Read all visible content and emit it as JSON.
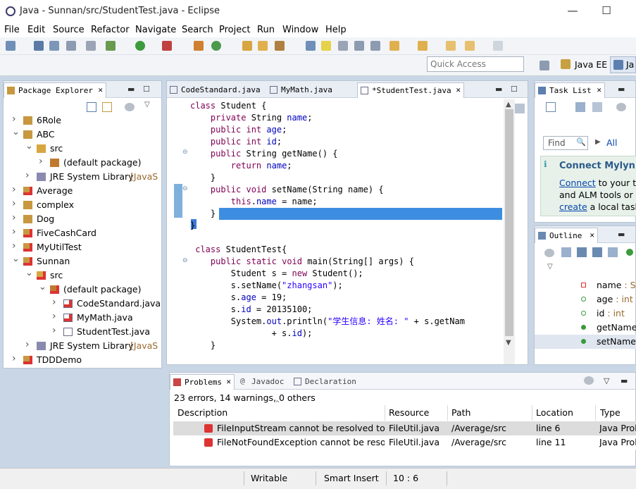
{
  "window": {
    "title": "Java - Sunnan/src/StudentTest.java - Eclipse",
    "minimize": "—",
    "maximize": "☐"
  },
  "menu": [
    "File",
    "Edit",
    "Source",
    "Refactor",
    "Navigate",
    "Search",
    "Project",
    "Run",
    "Window",
    "Help"
  ],
  "quick_access": {
    "placeholder": "Quick Access"
  },
  "perspectives": {
    "javaee": "Java EE",
    "java": "Ja"
  },
  "package_explorer": {
    "tab": "Package Explorer",
    "items": [
      {
        "label": "6Role",
        "level": 0,
        "expanded": false,
        "icon": "project-icon"
      },
      {
        "label": "ABC",
        "level": 0,
        "expanded": true,
        "icon": "project-icon"
      },
      {
        "label": "src",
        "level": 1,
        "expanded": true,
        "icon": "source-folder-icon"
      },
      {
        "label": "(default package)",
        "level": 2,
        "expanded": false,
        "icon": "package-icon"
      },
      {
        "label": "JRE System Library",
        "decoration": "[JavaS",
        "level": 1,
        "expanded": false,
        "icon": "library-icon"
      },
      {
        "label": "Average",
        "level": 0,
        "expanded": false,
        "icon": "project-error-icon"
      },
      {
        "label": "complex",
        "level": 0,
        "expanded": false,
        "icon": "project-icon"
      },
      {
        "label": "Dog",
        "level": 0,
        "expanded": false,
        "icon": "project-icon"
      },
      {
        "label": "FiveCashCard",
        "level": 0,
        "expanded": false,
        "icon": "project-error-icon"
      },
      {
        "label": "MyUtilTest",
        "level": 0,
        "expanded": false,
        "icon": "project-error-icon"
      },
      {
        "label": "Sunnan",
        "level": 0,
        "expanded": true,
        "icon": "project-error-icon"
      },
      {
        "label": "src",
        "level": 1,
        "expanded": true,
        "icon": "source-folder-error-icon"
      },
      {
        "label": "(default package)",
        "level": 2,
        "expanded": true,
        "icon": "package-error-icon"
      },
      {
        "label": "CodeStandard.java",
        "level": 3,
        "expanded": false,
        "icon": "java-file-error-icon"
      },
      {
        "label": "MyMath.java",
        "level": 3,
        "expanded": false,
        "icon": "java-file-error-icon"
      },
      {
        "label": "StudentTest.java",
        "level": 3,
        "expanded": false,
        "icon": "java-file-icon"
      },
      {
        "label": "JRE System Library",
        "decoration": "[JavaS",
        "level": 1,
        "expanded": false,
        "icon": "library-icon"
      },
      {
        "label": "TDDDemo",
        "level": 0,
        "expanded": false,
        "icon": "project-error-icon"
      }
    ]
  },
  "editor": {
    "tabs": [
      {
        "label": "CodeStandard.java",
        "active": false
      },
      {
        "label": "MyMath.java",
        "active": false
      },
      {
        "label": "*StudentTest.java",
        "active": true
      }
    ],
    "lines": [
      [
        [
          "kw",
          "class"
        ],
        [
          "",
          " Student {"
        ]
      ],
      [
        [
          "",
          "    "
        ],
        [
          "kw",
          "private"
        ],
        [
          "",
          " String "
        ],
        [
          "fld",
          "name"
        ],
        [
          "",
          ";"
        ]
      ],
      [
        [
          "",
          "    "
        ],
        [
          "kw",
          "public"
        ],
        [
          "",
          " "
        ],
        [
          "kw",
          "int"
        ],
        [
          "",
          " "
        ],
        [
          "fld",
          "age"
        ],
        [
          "",
          ";"
        ]
      ],
      [
        [
          "",
          "    "
        ],
        [
          "kw",
          "public"
        ],
        [
          "",
          " "
        ],
        [
          "kw",
          "int"
        ],
        [
          "",
          " "
        ],
        [
          "fld",
          "id"
        ],
        [
          "",
          ";"
        ]
      ],
      [
        [
          "",
          "    "
        ],
        [
          "kw",
          "public"
        ],
        [
          "",
          " String getName() {"
        ]
      ],
      [
        [
          "",
          "        "
        ],
        [
          "kw",
          "return"
        ],
        [
          "",
          " "
        ],
        [
          "fld",
          "name"
        ],
        [
          "",
          ";"
        ]
      ],
      [
        [
          "",
          "    }"
        ]
      ],
      [
        [
          "",
          "    "
        ],
        [
          "kw",
          "public"
        ],
        [
          "",
          " "
        ],
        [
          "kw",
          "void"
        ],
        [
          "",
          " setName(String name) {"
        ]
      ],
      [
        [
          "",
          "        "
        ],
        [
          "kw",
          "this"
        ],
        [
          "",
          "."
        ],
        [
          "fld",
          "name"
        ],
        [
          "",
          " = name;"
        ]
      ],
      [
        [
          "",
          "    }"
        ]
      ],
      [
        [
          "",
          "}"
        ]
      ],
      [
        [
          "",
          ""
        ]
      ],
      [
        [
          "",
          " "
        ],
        [
          "kw",
          "class"
        ],
        [
          "",
          " StudentTest{"
        ]
      ],
      [
        [
          "",
          "    "
        ],
        [
          "kw",
          "public"
        ],
        [
          "",
          " "
        ],
        [
          "kw",
          "static"
        ],
        [
          "",
          " "
        ],
        [
          "kw",
          "void"
        ],
        [
          "",
          " main(String[] args) {"
        ]
      ],
      [
        [
          "",
          "        Student s = "
        ],
        [
          "kw",
          "new"
        ],
        [
          "",
          " Student();"
        ]
      ],
      [
        [
          "",
          "        s.setName("
        ],
        [
          "str",
          "\"zhangsan\""
        ],
        [
          "",
          ");"
        ]
      ],
      [
        [
          "",
          "        s."
        ],
        [
          "fld",
          "age"
        ],
        [
          "",
          " = 19;"
        ]
      ],
      [
        [
          "",
          "        s."
        ],
        [
          "fld",
          "id"
        ],
        [
          "",
          " = 20135100;"
        ]
      ],
      [
        [
          "",
          "        System."
        ],
        [
          "fld",
          "out"
        ],
        [
          "",
          ".println("
        ],
        [
          "str",
          "\"学生信息: 姓名: \""
        ],
        [
          "",
          " + s.getNam"
        ]
      ],
      [
        [
          "",
          "                + s."
        ],
        [
          "fld",
          "id"
        ],
        [
          "",
          ");"
        ]
      ],
      [
        [
          "",
          "    }"
        ]
      ]
    ]
  },
  "task_list": {
    "tab": "Task List",
    "find_placeholder": "Find",
    "all_label": "All"
  },
  "connect_mylyn": {
    "title": "Connect Mylyn",
    "line1_link": "Connect",
    "line1_rest": " to your tas",
    "line2": "and ALM tools or",
    "line3_link": "create",
    "line3_rest": " a local task."
  },
  "outline": {
    "tab": "Outline",
    "items": [
      {
        "label": "name",
        "type": " : St",
        "icon": "private-field-icon"
      },
      {
        "label": "age",
        "type": " : int",
        "icon": "default-field-icon"
      },
      {
        "label": "id",
        "type": " : int",
        "icon": "default-field-icon"
      },
      {
        "label": "getName",
        "type": "",
        "icon": "public-method-icon"
      },
      {
        "label": "setName(",
        "type": "",
        "icon": "public-method-icon"
      }
    ]
  },
  "bottom_tabs": {
    "problems": "Problems",
    "javadoc": "Javadoc",
    "declaration": "Declaration"
  },
  "problems": {
    "summary": "23 errors, 14 warnings, 0 others",
    "columns": [
      "Description",
      "Resource",
      "Path",
      "Location",
      "Type"
    ],
    "rows": [
      {
        "description": "FileInputStream cannot be resolved to a",
        "resource": "FileUtil.java",
        "path": "/Average/src",
        "location": "line 6",
        "type": "Java Prob"
      },
      {
        "description": "FileNotFoundException cannot be resolve",
        "resource": "FileUtil.java",
        "path": "/Average/src",
        "location": "line 11",
        "type": "Java Prob"
      }
    ]
  },
  "statusbar": {
    "writable": "Writable",
    "insert_mode": "Smart Insert",
    "position": "10 : 6"
  }
}
